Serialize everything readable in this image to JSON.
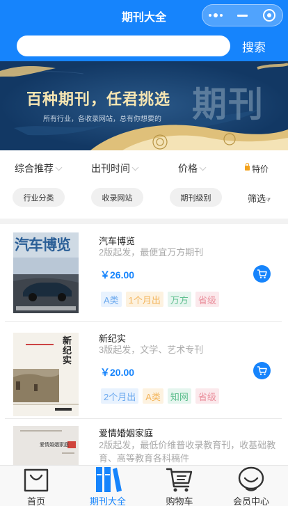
{
  "header": {
    "title": "期刊大全",
    "search_placeholder": "",
    "search_button": "搜索"
  },
  "banner": {
    "headline": "百种期刊，任君挑选",
    "subtitle": "所有行业，各收录网站，总有你想要的",
    "big_text": "期刊"
  },
  "sort_tabs": [
    {
      "label": "综合推荐"
    },
    {
      "label": "出刊时间"
    },
    {
      "label": "价格"
    },
    {
      "label": "特价"
    }
  ],
  "filter_chips": [
    {
      "label": "行业分类"
    },
    {
      "label": "收录网站"
    },
    {
      "label": "期刊级别"
    }
  ],
  "filter_button": "筛选",
  "items": [
    {
      "title": "汽车博览",
      "desc": "2版起发，最便宜万方期刊",
      "price": "￥26.00",
      "cover_title": "汽车博览",
      "tags": [
        {
          "text": "A类",
          "color": "blue"
        },
        {
          "text": "1个月出",
          "color": "orange"
        },
        {
          "text": "万方",
          "color": "green"
        },
        {
          "text": "省级",
          "color": "red"
        }
      ]
    },
    {
      "title": "新纪实",
      "desc": "3版起发，文学、艺术专刊",
      "price": "￥20.00",
      "cover_title": "新纪实",
      "tags": [
        {
          "text": "2个月出",
          "color": "blue"
        },
        {
          "text": "A类",
          "color": "orange"
        },
        {
          "text": "知网",
          "color": "green"
        },
        {
          "text": "省级",
          "color": "red"
        }
      ]
    },
    {
      "title": "爱情婚姻家庭",
      "desc": "2版起发，最低价维普收录教育刊，收基础教育、高等教育各科稿件",
      "cover_title": "爱情婚姻家庭"
    }
  ],
  "tabbar": [
    {
      "label": "首页",
      "icon": "bag-icon",
      "active": false
    },
    {
      "label": "期刊大全",
      "icon": "books-icon",
      "active": true
    },
    {
      "label": "购物车",
      "icon": "cart-icon",
      "active": false
    },
    {
      "label": "会员中心",
      "icon": "smile-icon",
      "active": false
    }
  ],
  "colors": {
    "primary": "#1684fc",
    "banner_bg": "#123864",
    "price": "#1684fc"
  }
}
